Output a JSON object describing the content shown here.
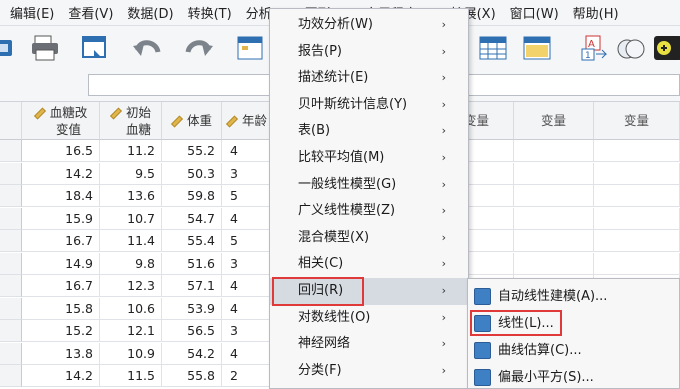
{
  "menubar": {
    "items": [
      "编辑(E)",
      "查看(V)",
      "数据(D)",
      "转换(T)",
      "分析(A)",
      "图形(G)",
      "实用程序(U)",
      "扩展(X)",
      "窗口(W)",
      "帮助(H)"
    ]
  },
  "toolbar": {
    "icons": [
      "open-file-icon",
      "print-icon",
      "recall-dialog-icon",
      "undo-icon",
      "redo-icon",
      "goto-case-icon",
      "variables-icon",
      "weight-cases-icon",
      "select-cases-icon",
      "value-labels-icon",
      "use-sets-icon"
    ]
  },
  "grid": {
    "headers": [
      "血糖改\n变值",
      "初始\n血糖",
      "体重",
      "年龄"
    ],
    "empty_headers": [
      "变量",
      "变量",
      "变量"
    ],
    "rows": [
      [
        "16.5",
        "11.2",
        "55.2",
        "4"
      ],
      [
        "14.2",
        "9.5",
        "50.3",
        "3"
      ],
      [
        "18.4",
        "13.6",
        "59.8",
        "5"
      ],
      [
        "15.9",
        "10.7",
        "54.7",
        "4"
      ],
      [
        "16.7",
        "11.4",
        "55.4",
        "5"
      ],
      [
        "14.9",
        "9.8",
        "51.6",
        "3"
      ],
      [
        "16.7",
        "12.3",
        "57.1",
        "4"
      ],
      [
        "15.8",
        "10.6",
        "53.9",
        "4"
      ],
      [
        "15.2",
        "12.1",
        "56.5",
        "3"
      ],
      [
        "13.8",
        "10.9",
        "54.2",
        "4"
      ],
      [
        "14.2",
        "11.5",
        "55.8",
        "2"
      ]
    ]
  },
  "analyze_menu": {
    "items": [
      {
        "label": "功效分析(W)"
      },
      {
        "label": "报告(P)"
      },
      {
        "label": "描述统计(E)"
      },
      {
        "label": "贝叶斯统计信息(Y)"
      },
      {
        "label": "表(B)"
      },
      {
        "label": "比较平均值(M)"
      },
      {
        "label": "一般线性模型(G)"
      },
      {
        "label": "广义线性模型(Z)"
      },
      {
        "label": "混合模型(X)"
      },
      {
        "label": "相关(C)"
      },
      {
        "label": "回归(R)"
      },
      {
        "label": "对数线性(O)"
      },
      {
        "label": "神经网络"
      },
      {
        "label": "分类(F)"
      }
    ],
    "arrow": "›",
    "highlighted": "回归(R)"
  },
  "regression_submenu": {
    "items": [
      {
        "label": "自动线性建模(A)...",
        "icon": "auto-linear-icon"
      },
      {
        "label": "线性(L)...",
        "icon": "linear-regression-icon"
      },
      {
        "label": "曲线估算(C)...",
        "icon": "curve-estimation-icon"
      },
      {
        "label": "偏最小平方(S)...",
        "icon": "partial-least-squares-icon"
      }
    ],
    "highlighted": "线性(L)..."
  },
  "colors": {
    "highlight_box": "#e0393a",
    "menu_bg": "#f7f7f7",
    "active_bg": "#d6dbe2"
  }
}
